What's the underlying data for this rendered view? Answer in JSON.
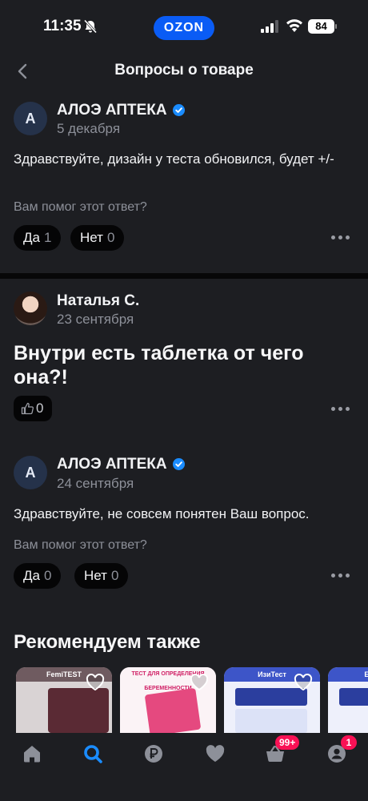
{
  "status_bar": {
    "time": "11:35",
    "battery": "84",
    "brand": "OZON"
  },
  "header": {
    "title": "Вопросы о товаре"
  },
  "answer1": {
    "avatar_letter": "А",
    "author": "АЛОЭ АПТЕКА",
    "date": "5 декабря",
    "text": "Здравствуйте, дизайн у теста обновился, будет +/-",
    "helped_label": "Вам помог этот ответ?",
    "yes_label": "Да",
    "yes_count": "1",
    "no_label": "Нет",
    "no_count": "0"
  },
  "question": {
    "author": "Наталья С.",
    "date": "23 сентября",
    "text": "Внутри есть таблетка от чего она?!",
    "likes": "0"
  },
  "answer2": {
    "avatar_letter": "А",
    "author": "АЛОЭ АПТЕКА",
    "date": "24 сентября",
    "text": "Здравствуйте, не совсем понятен Ваш вопрос.",
    "helped_label": "Вам помог этот ответ?",
    "yes_label": "Да",
    "yes_count": "0",
    "no_label": "Нет",
    "no_count": "0"
  },
  "recommend": {
    "title": "Рекомендуем также",
    "cards": [
      {
        "band_text": "FemiTEST"
      },
      {
        "band_text": "ТЕСТ ДЛЯ ОПРЕДЕЛЕНИЯ БЕРЕМЕННОСТИ"
      },
      {
        "band_text": "ИзиТест"
      },
      {
        "band_text": "EZTest"
      }
    ]
  },
  "bottom_nav": {
    "cart_badge": "99+",
    "profile_badge": "1"
  },
  "colors": {
    "background": "#1d1e22",
    "accent": "#0a5cf5",
    "badge": "#f91155",
    "verified": "#1a8cff"
  }
}
